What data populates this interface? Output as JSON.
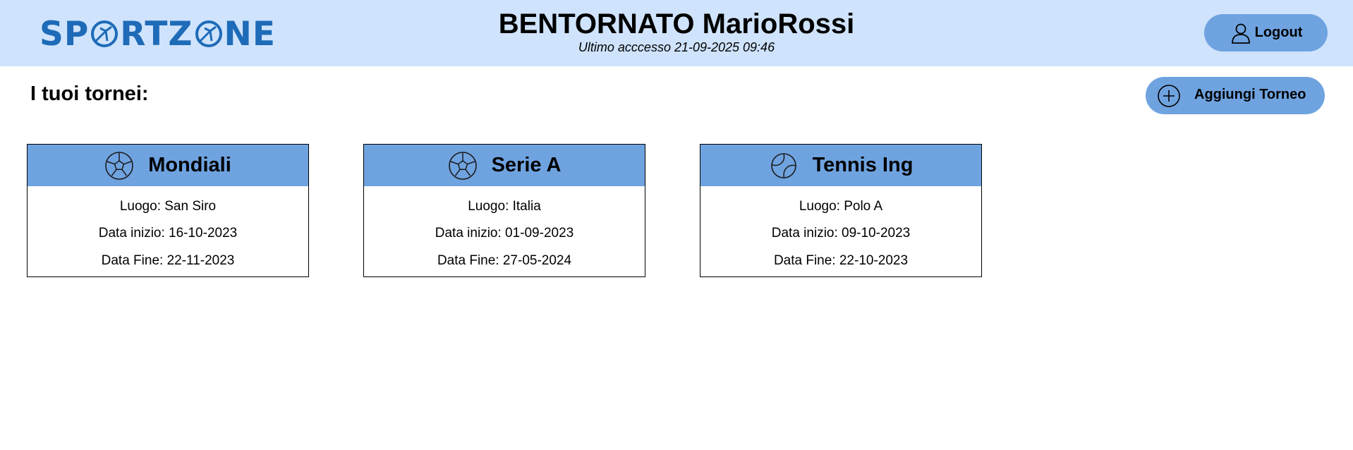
{
  "header": {
    "logo": {
      "part1": "SP",
      "part2": "RTZ",
      "part3": "NE",
      "ball_icon": "soccer-ball-icon"
    },
    "welcome": "BENTORNATO MarioRossi",
    "last_access": "Ultimo acccesso 21-09-2025 09:46",
    "logout_label": "Logout",
    "logout_icon": "user-icon"
  },
  "main": {
    "title": "I tuoi tornei:",
    "add_button": {
      "label": "Aggiungi Torneo",
      "icon": "plus-circle-icon"
    },
    "tournaments": [
      {
        "name": "Mondiali",
        "icon": "soccer-ball-icon",
        "luogo": "Luogo: San Siro",
        "data_inizio": "Data inizio: 16-10-2023",
        "data_fine": "Data Fine: 22-11-2023"
      },
      {
        "name": "Serie A",
        "icon": "soccer-ball-icon",
        "luogo": "Luogo: Italia",
        "data_inizio": "Data inizio: 01-09-2023",
        "data_fine": "Data Fine: 27-05-2024"
      },
      {
        "name": "Tennis Ing",
        "icon": "tennis-ball-icon",
        "luogo": "Luogo: Polo A",
        "data_inizio": "Data inizio: 09-10-2023",
        "data_fine": "Data Fine: 22-10-2023"
      }
    ]
  },
  "colors": {
    "header_bg": "#cfe3fc",
    "accent": "#6fa3e0",
    "logo": "#1e6bb8"
  }
}
